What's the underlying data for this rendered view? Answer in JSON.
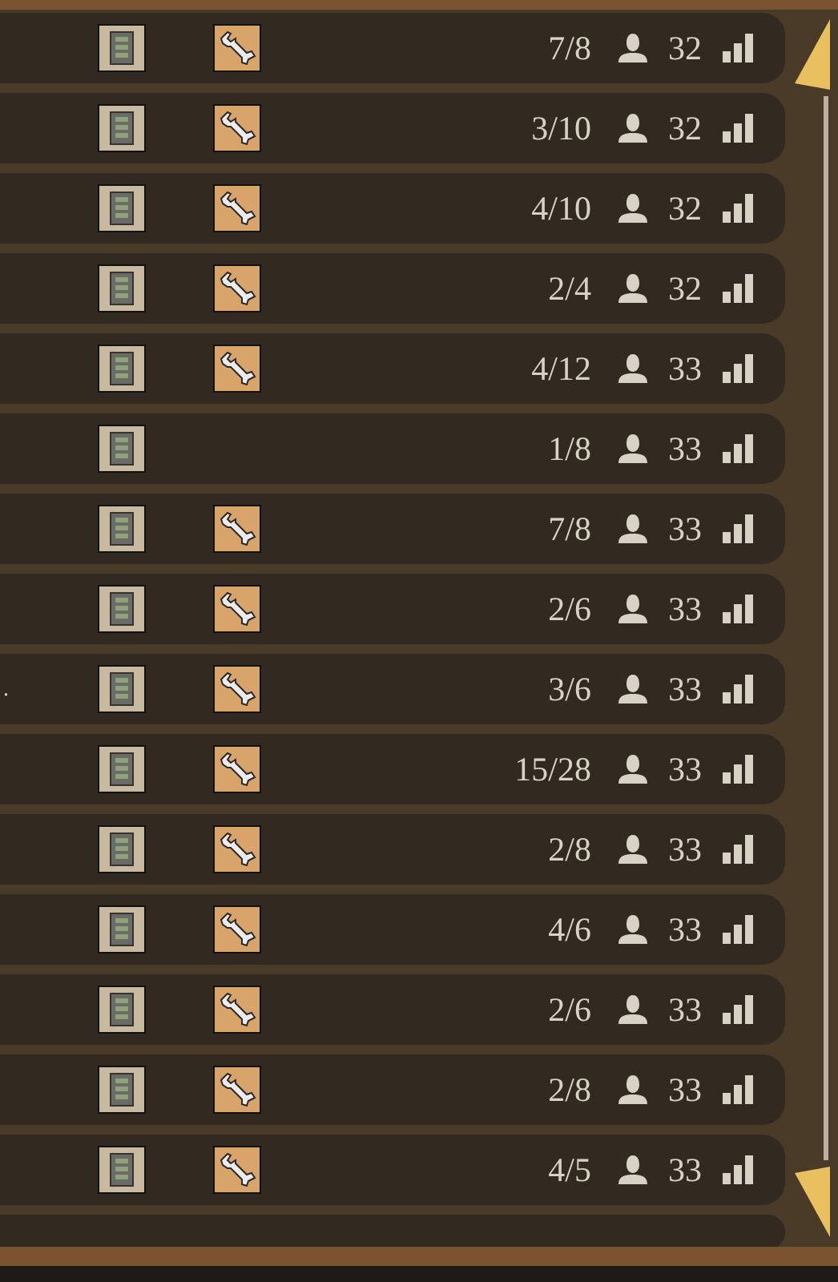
{
  "servers": [
    {
      "players": "7/8",
      "ping": "32",
      "modded": true
    },
    {
      "players": "3/10",
      "ping": "32",
      "modded": true
    },
    {
      "players": "4/10",
      "ping": "32",
      "modded": true
    },
    {
      "players": "2/4",
      "ping": "32",
      "modded": true
    },
    {
      "players": "4/12",
      "ping": "33",
      "modded": true
    },
    {
      "players": "1/8",
      "ping": "33",
      "modded": false
    },
    {
      "players": "7/8",
      "ping": "33",
      "modded": true
    },
    {
      "players": "2/6",
      "ping": "33",
      "modded": true
    },
    {
      "name": ".",
      "players": "3/6",
      "ping": "33",
      "modded": true
    },
    {
      "players": "15/28",
      "ping": "33",
      "modded": true
    },
    {
      "players": "2/8",
      "ping": "33",
      "modded": true
    },
    {
      "players": "4/6",
      "ping": "33",
      "modded": true
    },
    {
      "players": "2/6",
      "ping": "33",
      "modded": true
    },
    {
      "players": "2/8",
      "ping": "33",
      "modded": true
    },
    {
      "players": "4/5",
      "ping": "33",
      "modded": true
    }
  ]
}
